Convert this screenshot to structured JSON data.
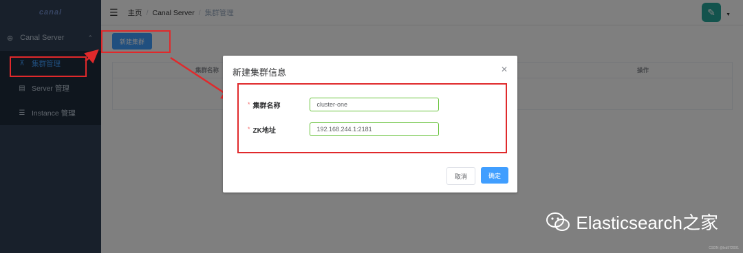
{
  "sidebar": {
    "logo": "canal",
    "group_label": "Canal Server",
    "items": [
      {
        "label": "集群管理",
        "icon": "cluster-icon"
      },
      {
        "label": "Server 管理",
        "icon": "server-icon"
      },
      {
        "label": "Instance 管理",
        "icon": "instance-icon"
      }
    ]
  },
  "navbar": {
    "breadcrumb": [
      "主页",
      "Canal Server",
      "集群管理"
    ]
  },
  "page": {
    "new_button": "新建集群",
    "table_headers": [
      "集群名称",
      "操作"
    ]
  },
  "dialog": {
    "title": "新建集群信息",
    "fields": [
      {
        "label": "集群名称",
        "value": "cluster-one"
      },
      {
        "label": "ZK地址",
        "value": "192.168.244.1:2181"
      }
    ],
    "cancel_label": "取消",
    "confirm_label": "确定"
  },
  "watermark": {
    "text": "Elasticsearch之家",
    "small_text": "CSDN @lxd972001"
  },
  "colors": {
    "accent": "#409eff",
    "annotation_red": "#e0292b",
    "input_border": "#67c23a",
    "sidebar_bg": "#304156"
  }
}
